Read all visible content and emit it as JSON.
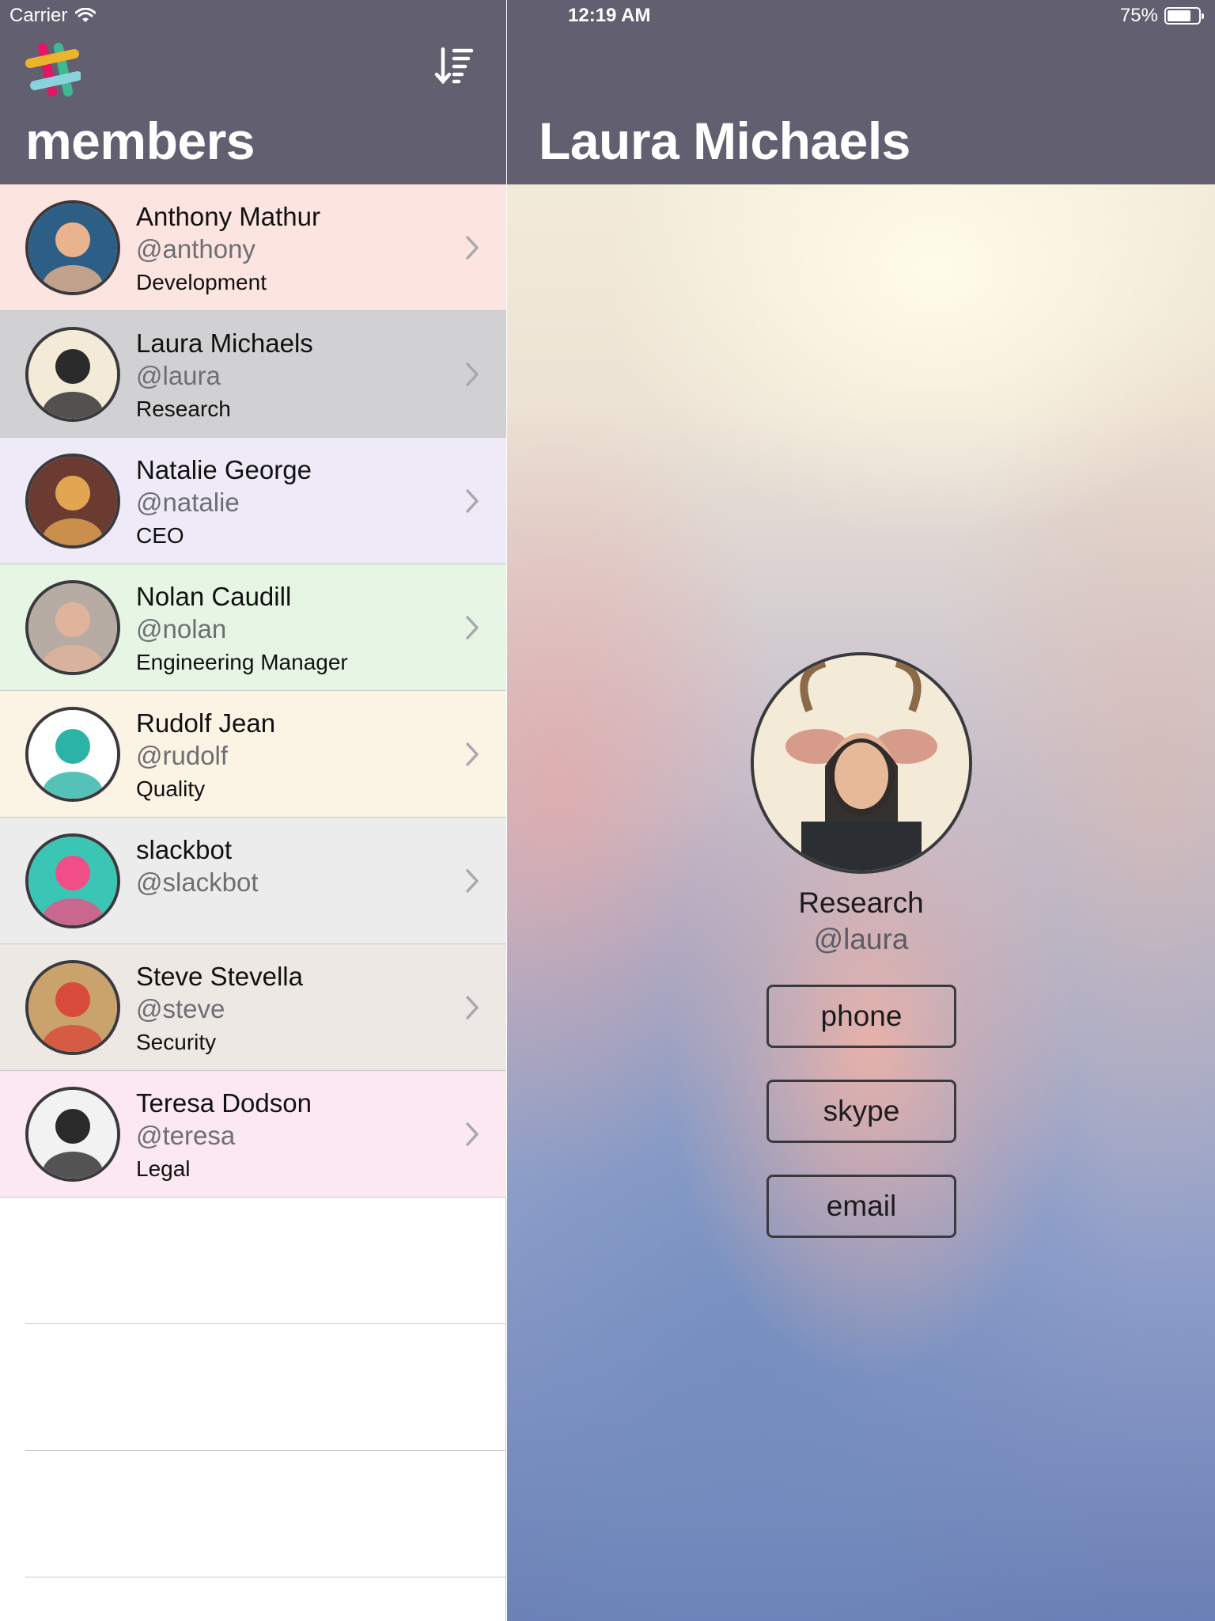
{
  "status_bar": {
    "carrier": "Carrier",
    "time": "12:19 AM",
    "battery_percent": "75%",
    "battery_level": 0.75,
    "wifi_icon": "wifi-icon"
  },
  "master": {
    "title": "members",
    "logo_icon": "slack-logo-icon",
    "sort_icon": "sort-icon",
    "members": [
      {
        "name": "Anthony Mathur",
        "handle": "@anthony",
        "title": "Development",
        "bg": "#fce4e1",
        "avatar_colors": [
          "#2d5f86",
          "#e9b38e"
        ]
      },
      {
        "name": "Laura Michaels",
        "handle": "@laura",
        "title": "Research",
        "bg": "#d1d1d3",
        "avatar_colors": [
          "#f3ead7",
          "#2b2b2b"
        ]
      },
      {
        "name": "Natalie George",
        "handle": "@natalie",
        "title": "CEO",
        "bg": "#efeaf8",
        "avatar_colors": [
          "#6b3b32",
          "#e2a552"
        ]
      },
      {
        "name": "Nolan Caudill",
        "handle": "@nolan",
        "title": "Engineering Manager",
        "bg": "#e7f6e4",
        "avatar_colors": [
          "#b7aca4",
          "#e0b49a"
        ]
      },
      {
        "name": "Rudolf Jean",
        "handle": "@rudolf",
        "title": "Quality",
        "bg": "#fbf3e4",
        "avatar_colors": [
          "#ffffff",
          "#2bb3a6"
        ]
      },
      {
        "name": "slackbot",
        "handle": "@slackbot",
        "title": "",
        "bg": "#ececec",
        "avatar_colors": [
          "#3bc5b5",
          "#ef4f86"
        ]
      },
      {
        "name": "Steve Stevella",
        "handle": "@steve",
        "title": "Security",
        "bg": "#ede8e3",
        "avatar_colors": [
          "#c9a26c",
          "#d84b3a"
        ]
      },
      {
        "name": "Teresa Dodson",
        "handle": "@teresa",
        "title": "Legal",
        "bg": "#fbe8f1",
        "avatar_colors": [
          "#f2f2f2",
          "#2a2a2a"
        ]
      }
    ],
    "empty_rows": 3
  },
  "detail": {
    "title": "Laura Michaels",
    "department": "Research",
    "handle": "@laura",
    "buttons": {
      "phone": "phone",
      "skype": "skype",
      "email": "email"
    }
  }
}
